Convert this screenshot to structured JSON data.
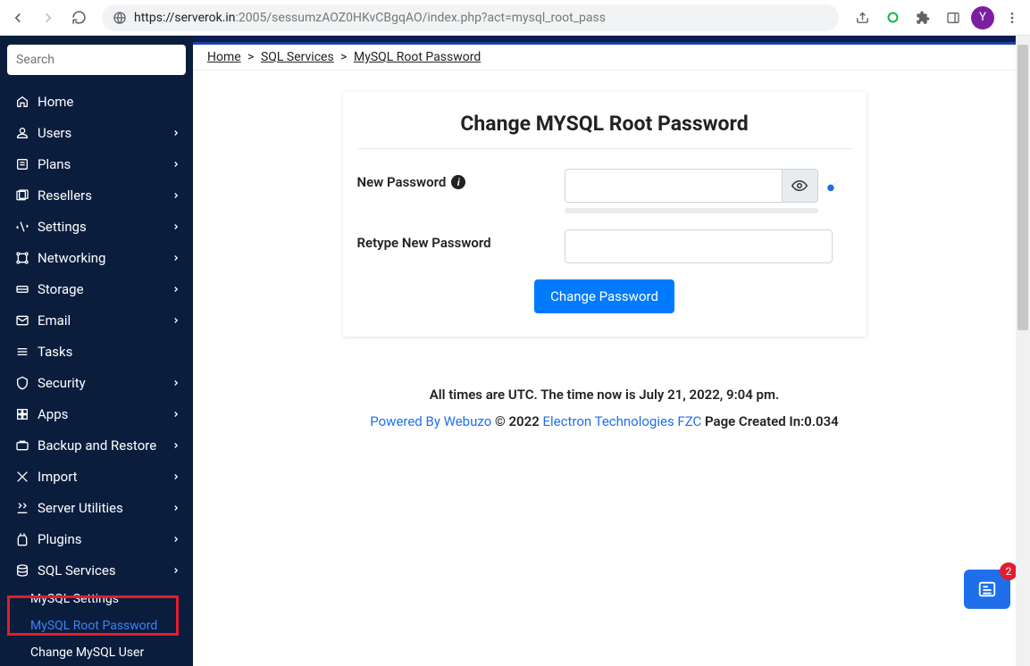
{
  "browser": {
    "url_host": "https://serverok.in",
    "url_path": ":2005/sessumzAOZ0HKvCBgqAO/index.php?act=mysql_root_pass",
    "avatar_initial": "Y"
  },
  "sidebar": {
    "search_placeholder": "Search",
    "items": [
      {
        "label": "Home",
        "expandable": false
      },
      {
        "label": "Users",
        "expandable": true
      },
      {
        "label": "Plans",
        "expandable": true
      },
      {
        "label": "Resellers",
        "expandable": true
      },
      {
        "label": "Settings",
        "expandable": true
      },
      {
        "label": "Networking",
        "expandable": true
      },
      {
        "label": "Storage",
        "expandable": true
      },
      {
        "label": "Email",
        "expandable": true
      },
      {
        "label": "Tasks",
        "expandable": false
      },
      {
        "label": "Security",
        "expandable": true
      },
      {
        "label": "Apps",
        "expandable": true
      },
      {
        "label": "Backup and Restore",
        "expandable": true
      },
      {
        "label": "Import",
        "expandable": true
      },
      {
        "label": "Server Utilities",
        "expandable": true
      },
      {
        "label": "Plugins",
        "expandable": true
      },
      {
        "label": "SQL Services",
        "expandable": true
      }
    ],
    "sql_submenu": [
      {
        "label": "MySQL Settings",
        "active": false
      },
      {
        "label": "MySQL Root Password",
        "active": true
      },
      {
        "label": "Change MySQL User",
        "active": false
      }
    ]
  },
  "breadcrumb": {
    "home": "Home",
    "sql": "SQL Services",
    "current": "MySQL Root Password"
  },
  "card": {
    "title": "Change MYSQL Root Password",
    "new_password_label": "New Password",
    "retype_label": "Retype New Password",
    "submit_label": "Change Password"
  },
  "footer": {
    "time_line": "All times are UTC. The time now is July 21, 2022, 9:04 pm.",
    "powered_by": "Powered By Webuzo",
    "copyright": " © 2022 ",
    "company": "Electron Technologies FZC",
    "page_created": "   Page Created In:0.034"
  },
  "news_badge": {
    "count": "2"
  }
}
